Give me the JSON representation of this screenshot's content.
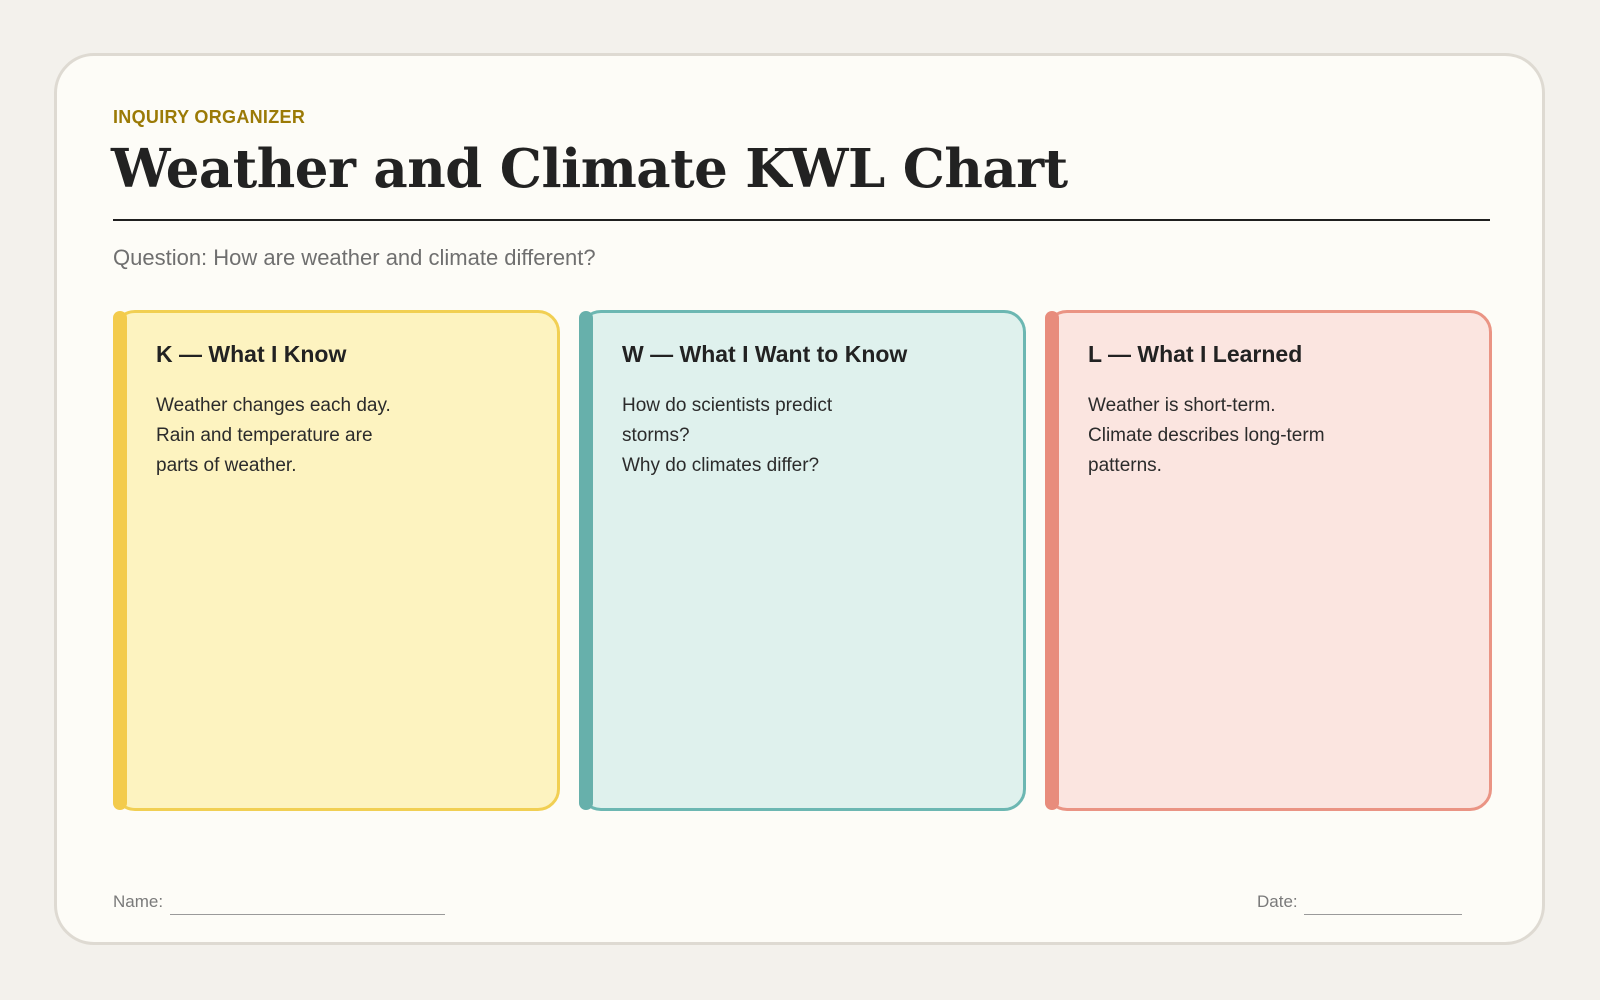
{
  "header": {
    "eyebrow": "INQUIRY ORGANIZER",
    "title": "Weather and Climate KWL Chart",
    "question": "Question: How are weather and climate different?"
  },
  "columns": [
    {
      "heading": "K — What I Know",
      "lines": [
        "Weather changes each day.",
        "Rain and temperature are",
        "parts of weather."
      ],
      "color": "#f3cb4c"
    },
    {
      "heading": "W — What I Want to Know",
      "lines": [
        "How do scientists predict",
        "storms?",
        "Why do climates differ?"
      ],
      "color": "#67b0ab"
    },
    {
      "heading": "L — What I Learned",
      "lines": [
        "Weather is short-term.",
        "Climate describes long-term",
        "patterns."
      ],
      "color": "#e88c7c"
    }
  ],
  "footer": {
    "name_label": "Name:",
    "date_label": "Date:"
  }
}
